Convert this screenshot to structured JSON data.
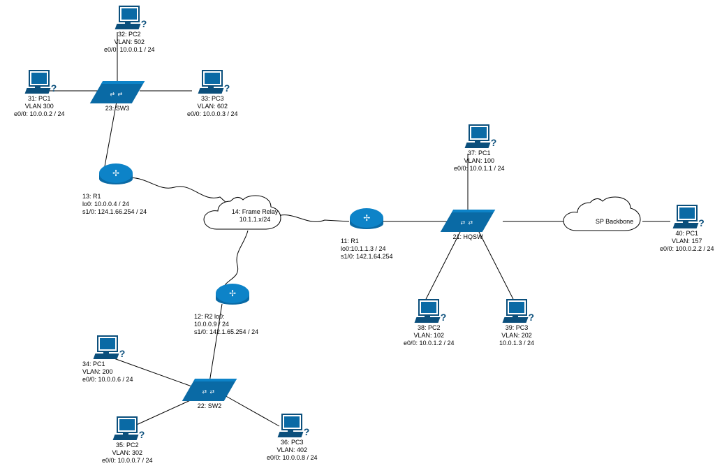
{
  "nodes": {
    "pc32": {
      "l1": "32: PC2",
      "l2": "VLAN: 502",
      "l3": "e0/0: 10.0.0.1 / 24"
    },
    "pc31": {
      "l1": "31: PC1",
      "l2": "VLAN 300",
      "l3": "e0/0: 10.0.0.2 / 24"
    },
    "sw23": {
      "l1": "23: SW3"
    },
    "pc33": {
      "l1": "33: PC3",
      "l2": "VLAN: 602",
      "l3": "e0/0: 10.0.0.3 / 24"
    },
    "r13": {
      "l1": "13: R1",
      "l2": "lo0: 10.0.0.4 / 24",
      "l3": "s1/0: 124.1.66.254 / 24"
    },
    "cloud14": {
      "l1": "14: Frame Relay",
      "l2": "10.1.1.x/24"
    },
    "r11": {
      "l1": "11: R1",
      "l2": "lo0:10.1.1.3 / 24",
      "l3": "s1/0: 142.1.64.254"
    },
    "r12": {
      "l1": "12: R2 lo0:",
      "l2": "10.0.0.9 / 24",
      "l3": "s1/0: 142.1.65.254 / 24"
    },
    "sw21": {
      "l1": "21: HQSW"
    },
    "pc37": {
      "l1": "37: PC1",
      "l2": "VLAN: 100",
      "l3": "e0/0: 10.0.1.1 / 24"
    },
    "pc38": {
      "l1": "38: PC2",
      "l2": "VLAN: 102",
      "l3": "e0/0: 10.0.1.2 / 24"
    },
    "pc39": {
      "l1": "39: PC3",
      "l2": "VLAN: 202",
      "l3": "10.0.1.3 / 24"
    },
    "cloudSP": {
      "inside": "SP Backbone"
    },
    "pc40": {
      "l1": "40: PC1",
      "l2": "VLAN: 157",
      "l3": "e0/0: 100.0.2.2 / 24"
    },
    "sw22": {
      "l1": "22: SW2"
    },
    "pc34": {
      "l1": "34: PC1",
      "l2": "VLAN: 200",
      "l3": "e0/0: 10.0.0.6 / 24"
    },
    "pc35": {
      "l1": "35: PC2",
      "l2": "VLAN: 302",
      "l3": "e0/0: 10.0.0.7 / 24"
    },
    "pc36": {
      "l1": "36: PC3",
      "l2": "VLAN: 402",
      "l3": "e0/0: 10.0.0.8 / 24"
    }
  }
}
